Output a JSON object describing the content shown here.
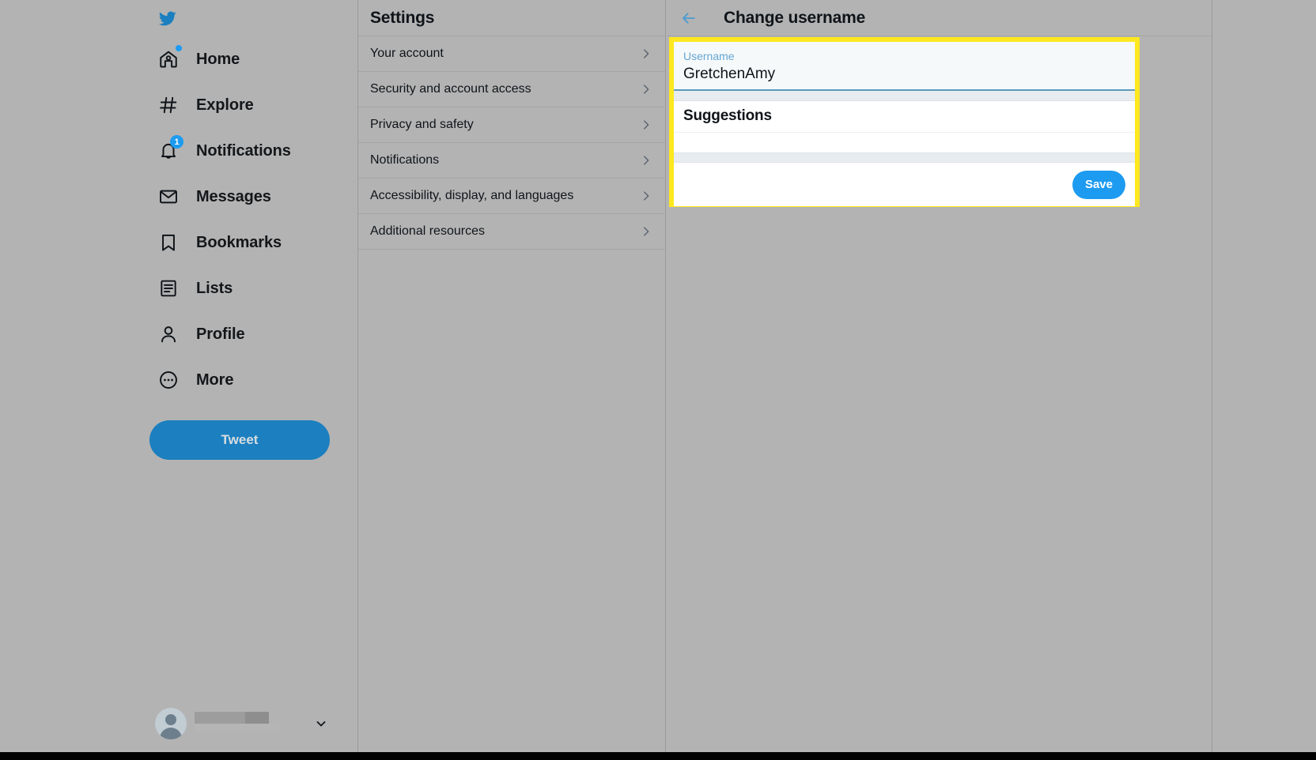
{
  "app": {
    "brand_icon": "twitter-bird-icon",
    "accent_color": "#1d9bf0",
    "highlight_color": "#ffe81f",
    "background_color": "#b3b3b3"
  },
  "sidebar": {
    "items": [
      {
        "label": "Home",
        "icon": "home-icon",
        "badge_type": "dot",
        "badge": ""
      },
      {
        "label": "Explore",
        "icon": "hashtag-icon",
        "badge_type": "none",
        "badge": ""
      },
      {
        "label": "Notifications",
        "icon": "bell-icon",
        "badge_type": "count",
        "badge": "1"
      },
      {
        "label": "Messages",
        "icon": "envelope-icon",
        "badge_type": "none",
        "badge": ""
      },
      {
        "label": "Bookmarks",
        "icon": "bookmark-icon",
        "badge_type": "none",
        "badge": ""
      },
      {
        "label": "Lists",
        "icon": "list-icon",
        "badge_type": "none",
        "badge": ""
      },
      {
        "label": "Profile",
        "icon": "person-icon",
        "badge_type": "none",
        "badge": ""
      },
      {
        "label": "More",
        "icon": "more-circle-icon",
        "badge_type": "none",
        "badge": ""
      }
    ],
    "tweet_button_label": "Tweet",
    "account_switcher": {
      "avatar_icon": "avatar-icon",
      "display_name": "",
      "handle": "",
      "chevron_icon": "chevron-down-icon"
    }
  },
  "settings": {
    "title": "Settings",
    "items": [
      {
        "label": "Your account",
        "chevron": "chevron-right-icon"
      },
      {
        "label": "Security and account access",
        "chevron": "chevron-right-icon"
      },
      {
        "label": "Privacy and safety",
        "chevron": "chevron-right-icon"
      },
      {
        "label": "Notifications",
        "chevron": "chevron-right-icon"
      },
      {
        "label": "Accessibility, display, and languages",
        "chevron": "chevron-right-icon"
      },
      {
        "label": "Additional resources",
        "chevron": "chevron-right-icon"
      }
    ]
  },
  "detail": {
    "back_icon": "back-arrow-icon",
    "title": "Change username",
    "username_label": "Username",
    "username_value": "GretchenAmy",
    "username_placeholder": "Username",
    "suggestions_title": "Suggestions",
    "suggestions": [],
    "save_label": "Save"
  }
}
